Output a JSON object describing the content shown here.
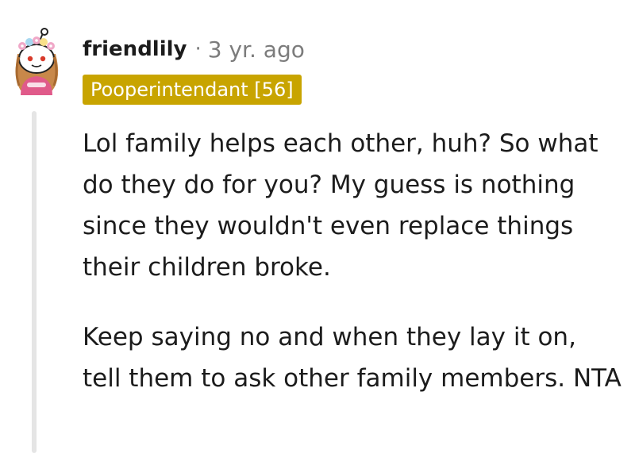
{
  "comment": {
    "username": "friendlily",
    "separator": "·",
    "timestamp": "3 yr. ago",
    "flair": "Pooperintendant [56]",
    "paragraphs": [
      "Lol family helps each other, huh? So what do they do for you? My guess is nothing since they wouldn't even replace things their children broke.",
      "Keep saying no and when they lay it on, tell them to ask other family members. NTA"
    ]
  },
  "avatar": {
    "icon": "snoo-avatar-with-flower-crown",
    "colors": {
      "flowers": "#f0a8c8",
      "hair": "#c8884a",
      "shirt": "#e05a8a",
      "face": "#ffffff"
    }
  },
  "colors": {
    "flair_bg": "#c8a400",
    "flair_text": "#ffffff",
    "meta_text": "#7c7c7c",
    "body_text": "#1c1c1c",
    "thread_line": "#e5e5e5"
  }
}
